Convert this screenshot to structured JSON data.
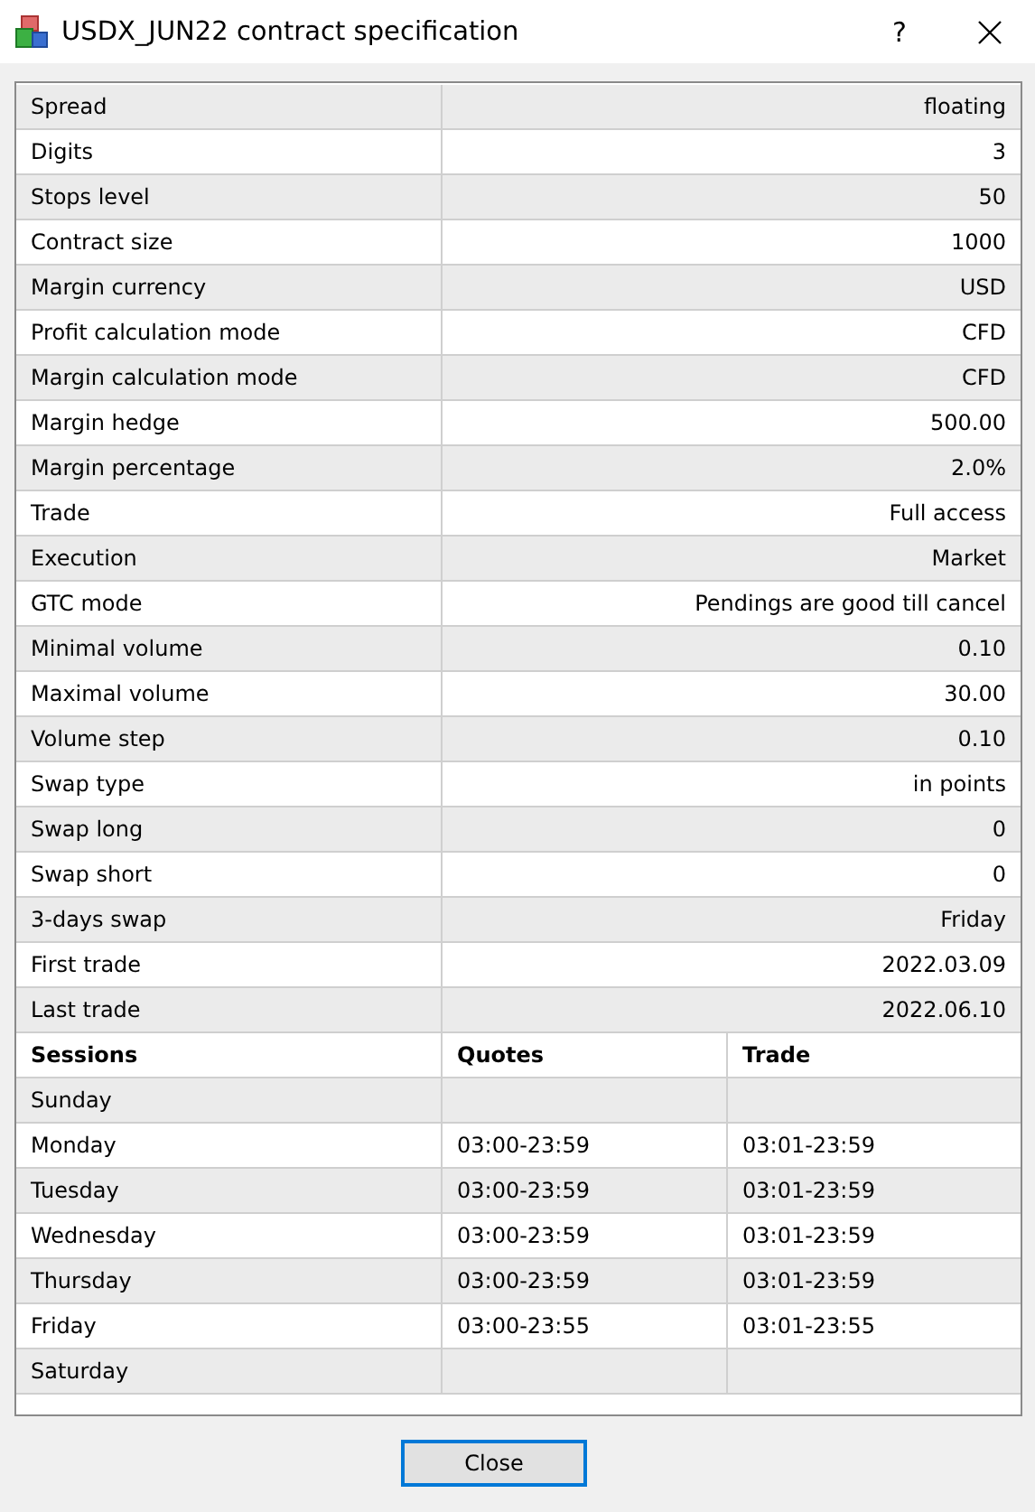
{
  "window": {
    "title": "USDX_JUN22 contract specification",
    "help": "?"
  },
  "spec": [
    {
      "label": "Spread",
      "value": "floating"
    },
    {
      "label": "Digits",
      "value": "3"
    },
    {
      "label": "Stops level",
      "value": "50"
    },
    {
      "label": "Contract size",
      "value": "1000"
    },
    {
      "label": "Margin currency",
      "value": "USD"
    },
    {
      "label": "Profit calculation mode",
      "value": "CFD"
    },
    {
      "label": "Margin calculation mode",
      "value": "CFD"
    },
    {
      "label": "Margin hedge",
      "value": "500.00"
    },
    {
      "label": "Margin percentage",
      "value": "2.0%"
    },
    {
      "label": "Trade",
      "value": "Full access"
    },
    {
      "label": "Execution",
      "value": "Market"
    },
    {
      "label": "GTC mode",
      "value": "Pendings are good till cancel"
    },
    {
      "label": "Minimal volume",
      "value": "0.10"
    },
    {
      "label": "Maximal volume",
      "value": "30.00"
    },
    {
      "label": "Volume step",
      "value": "0.10"
    },
    {
      "label": "Swap type",
      "value": "in points"
    },
    {
      "label": "Swap long",
      "value": "0"
    },
    {
      "label": "Swap short",
      "value": "0"
    },
    {
      "label": "3-days swap",
      "value": "Friday"
    },
    {
      "label": "First trade",
      "value": "2022.03.09"
    },
    {
      "label": "Last trade",
      "value": "2022.06.10"
    }
  ],
  "sessions": {
    "columns": [
      "Sessions",
      "Quotes",
      "Trade"
    ],
    "rows": [
      {
        "day": "Sunday"
      },
      {
        "day": "Monday",
        "quotes": "03:00-23:59",
        "trade": "03:01-23:59"
      },
      {
        "day": "Tuesday",
        "quotes": "03:00-23:59",
        "trade": "03:01-23:59"
      },
      {
        "day": "Wednesday",
        "quotes": "03:00-23:59",
        "trade": "03:01-23:59"
      },
      {
        "day": "Thursday",
        "quotes": "03:00-23:59",
        "trade": "03:01-23:59"
      },
      {
        "day": "Friday",
        "quotes": "03:00-23:55",
        "trade": "03:01-23:55"
      },
      {
        "day": "Saturday"
      }
    ]
  },
  "buttons": [
    "Close"
  ]
}
